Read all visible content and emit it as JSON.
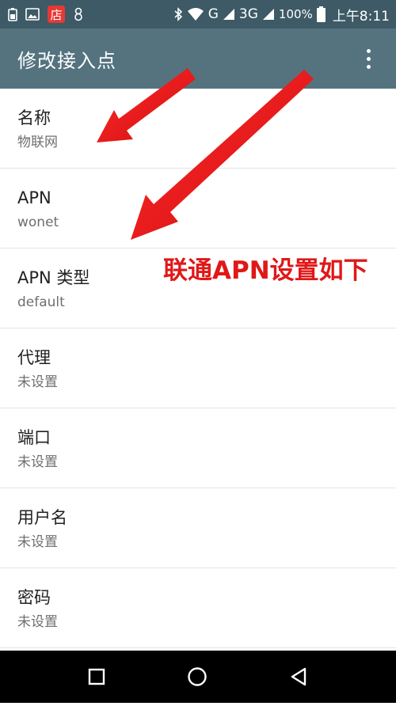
{
  "status_bar": {
    "store_badge": "店",
    "network_type": "G",
    "network_type_2": "3G",
    "battery": "100%",
    "time": "上午8:11",
    "icons": [
      "battery-saver-icon",
      "image-icon",
      "store-icon",
      "app-icon",
      "bluetooth-icon",
      "wifi-icon",
      "signal-icon",
      "battery-icon"
    ]
  },
  "app_bar": {
    "title": "修改接入点",
    "menu_icon": "more-vert-icon"
  },
  "items": [
    {
      "title": "名称",
      "summary": "物联网"
    },
    {
      "title": "APN",
      "summary": "wonet"
    },
    {
      "title": "APN 类型",
      "summary": "default"
    },
    {
      "title": "代理",
      "summary": "未设置"
    },
    {
      "title": "端口",
      "summary": "未设置"
    },
    {
      "title": "用户名",
      "summary": "未设置"
    },
    {
      "title": "密码",
      "summary": "未设置"
    }
  ],
  "annotation": {
    "text": "联通APN设置如下",
    "color": "#e01818"
  },
  "colors": {
    "status_bar": "#3d5a66",
    "app_bar": "#54737f",
    "nav_bar": "#000000"
  },
  "nav_bar": {
    "icons": [
      "recents-icon",
      "home-icon",
      "back-icon"
    ]
  }
}
